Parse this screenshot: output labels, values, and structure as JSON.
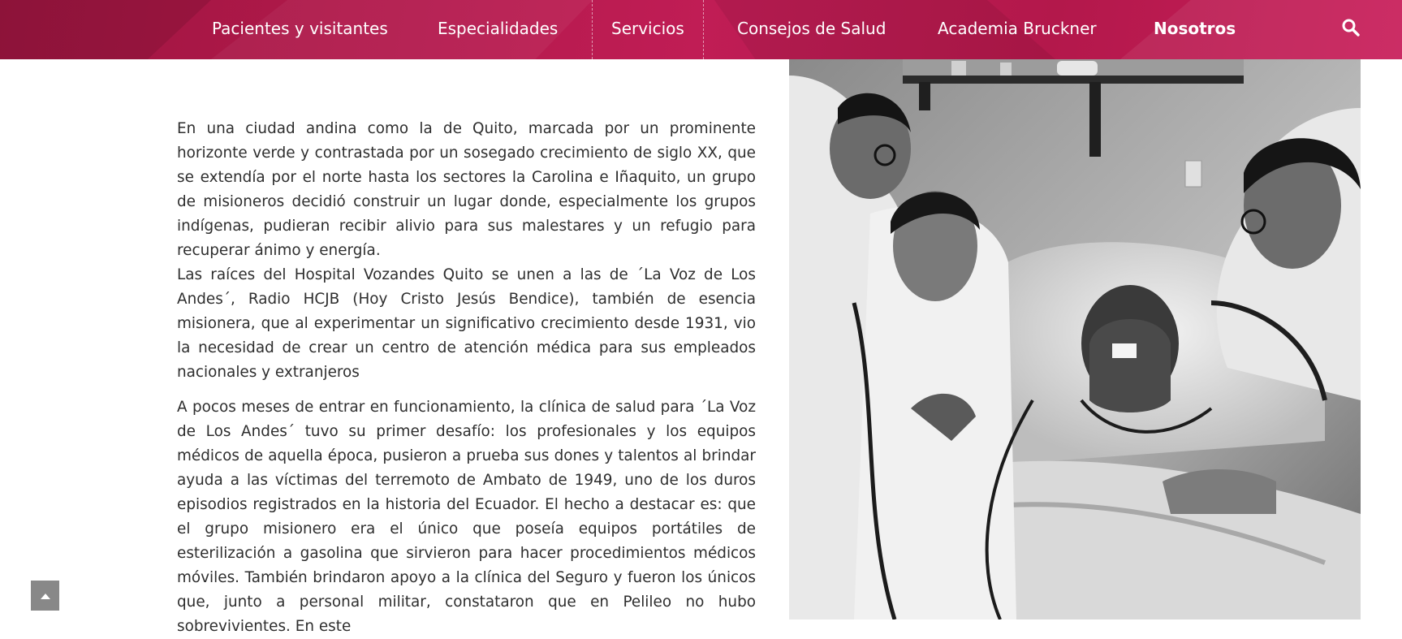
{
  "nav": {
    "items": [
      {
        "label": "Pacientes y visitantes",
        "active": false
      },
      {
        "label": "Especialidades",
        "active": false
      },
      {
        "label": "Servicios",
        "active": false
      },
      {
        "label": "Consejos de Salud",
        "active": false
      },
      {
        "label": "Academia Bruckner",
        "active": false
      },
      {
        "label": "Nosotros",
        "active": true
      }
    ],
    "search_icon": "search-icon",
    "colors": {
      "bar_start": "#9e1640",
      "bar_end": "#c81e5a",
      "text": "#ffffff"
    }
  },
  "article": {
    "paragraphs": [
      "En una ciudad andina como la de Quito, marcada por un prominente horizonte verde y contrastada por un sosegado crecimiento de siglo XX, que se extendía por el norte hasta los sectores la Carolina e Iñaquito, un grupo de misioneros decidió construir un lugar donde, especialmente los grupos indígenas, pudieran recibir alivio para sus malestares y un refugio para recuperar ánimo y energía.",
      "Las raíces del Hospital Vozandes Quito se unen a las de ´La Voz de Los Andes´, Radio HCJB (Hoy Cristo Jesús Bendice), también de esencia misionera, que al experimentar un significativo crecimiento desde 1931, vio la necesidad de crear un centro de atención médica para sus empleados nacionales y extranjeros",
      "A pocos meses de entrar en funcionamiento, la clínica de salud para ´La Voz de Los Andes´ tuvo su primer desafío: los profesionales y los equipos médicos de aquella época, pusieron a prueba sus dones y talentos al brindar ayuda a las víctimas del terremoto de Ambato de 1949, uno de los duros episodios registrados en la historia del Ecuador. El hecho a destacar es: que el grupo misionero era el único que poseía equipos portátiles de esterilización a gasolina que sirvieron para hacer procedimientos médicos móviles. También brindaron apoyo a la clínica del Seguro y fueron los únicos que, junto a personal militar, constataron que en Pelileo no hubo sobrevivientes. En este"
    ]
  },
  "photo": {
    "style": "black-and-white historical photo"
  },
  "scroll_top": {
    "icon": "chevron-up-icon"
  }
}
